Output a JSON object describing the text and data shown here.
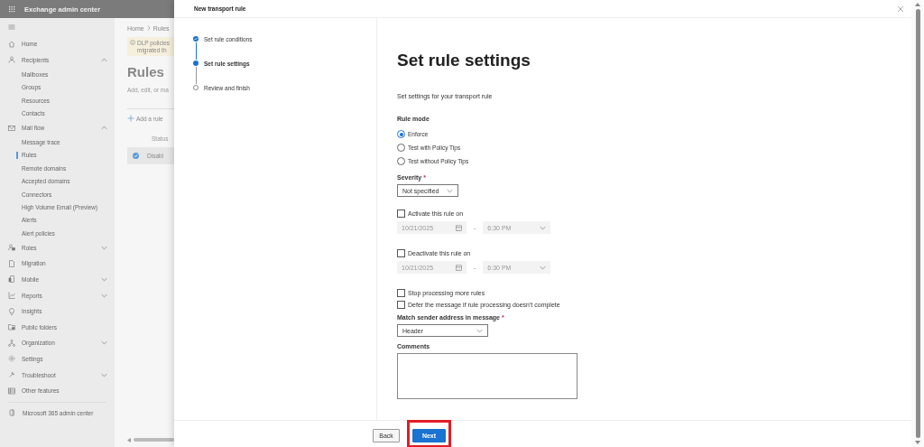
{
  "app_header": {
    "title": "Exchange admin center"
  },
  "sidebar": {
    "items": [
      {
        "label": "Home",
        "kind": "link"
      },
      {
        "label": "Recipients",
        "kind": "group",
        "expanded": true,
        "children": [
          {
            "label": "Mailboxes",
            "selected": false
          },
          {
            "label": "Groups",
            "selected": false
          },
          {
            "label": "Resources",
            "selected": false
          },
          {
            "label": "Contacts",
            "selected": false
          }
        ]
      },
      {
        "label": "Mail flow",
        "kind": "group",
        "expanded": true,
        "children": [
          {
            "label": "Message trace",
            "selected": false
          },
          {
            "label": "Rules",
            "selected": true
          },
          {
            "label": "Remote domains",
            "selected": false
          },
          {
            "label": "Accepted domains",
            "selected": false
          },
          {
            "label": "Connectors",
            "selected": false
          },
          {
            "label": "High Volume Email (Preview)",
            "selected": false
          },
          {
            "label": "Alerts",
            "selected": false
          },
          {
            "label": "Alert policies",
            "selected": false
          }
        ]
      },
      {
        "label": "Roles",
        "kind": "group",
        "expanded": false
      },
      {
        "label": "Migration",
        "kind": "link"
      },
      {
        "label": "Mobile",
        "kind": "group",
        "expanded": false
      },
      {
        "label": "Reports",
        "kind": "group",
        "expanded": false
      },
      {
        "label": "Insights",
        "kind": "link"
      },
      {
        "label": "Public folders",
        "kind": "link"
      },
      {
        "label": "Organization",
        "kind": "group",
        "expanded": false
      },
      {
        "label": "Settings",
        "kind": "link"
      },
      {
        "label": "Troubleshoot",
        "kind": "group",
        "expanded": false
      },
      {
        "label": "Other features",
        "kind": "link"
      }
    ],
    "footer_link": "Microsoft 365 admin center"
  },
  "page": {
    "breadcrumb": [
      "Home",
      "Rules"
    ],
    "banner": [
      "DLP policies",
      "migrated th"
    ],
    "title": "Rules",
    "description": "Add, edit, or ma",
    "add_button": "Add a rule",
    "table": {
      "columns": [
        "Status"
      ],
      "rows": [
        {
          "cells": [
            "Disabl"
          ],
          "selected": true
        }
      ]
    }
  },
  "panel": {
    "title": "New transport rule",
    "steps": [
      {
        "label": "Set rule conditions",
        "completed": true,
        "current": false
      },
      {
        "label": "Set rule settings",
        "completed": false,
        "current": true
      },
      {
        "label": "Review and finish",
        "completed": false,
        "current": false
      }
    ],
    "heading": "Set rule settings",
    "subtitle": "Set settings for your transport rule",
    "rule_mode": {
      "label": "Rule mode",
      "options": [
        {
          "label": "Enforce",
          "selected": true
        },
        {
          "label": "Test with Policy Tips",
          "selected": false
        },
        {
          "label": "Test without Policy Tips",
          "selected": false
        }
      ]
    },
    "severity": {
      "label": "Severity",
      "required_mark": "*",
      "value": "Not specified"
    },
    "schedules": [
      {
        "label": "Activate this rule on",
        "checked": false,
        "date": "10/21/2025",
        "separator": "-",
        "time": "6:30 PM",
        "disabled": true
      },
      {
        "label": "Deactivate this rule on",
        "checked": false,
        "date": "10/21/2025",
        "separator": "-",
        "time": "6:30 PM",
        "disabled": true
      }
    ],
    "options": [
      {
        "label": "Stop processing more rules",
        "checked": false
      },
      {
        "label": "Defer the message if rule processing doesn't complete",
        "checked": false
      }
    ],
    "match_sender": {
      "label": "Match sender address in message",
      "required_mark": "*",
      "value": "Header"
    },
    "comments": {
      "label": "Comments"
    },
    "buttons": [
      {
        "label": "Back",
        "kind": "secondary",
        "highlighted": false
      },
      {
        "label": "Next",
        "kind": "primary",
        "highlighted": true
      }
    ]
  }
}
